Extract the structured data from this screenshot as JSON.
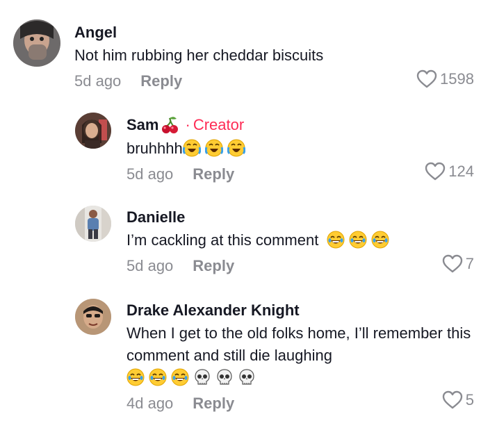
{
  "comments": [
    {
      "username": "Angel",
      "text": "Not him rubbing her cheddar biscuits",
      "time": "5d ago",
      "reply_label": "Reply",
      "likes": "1598"
    },
    {
      "username": "Sam",
      "creator_dot": "·",
      "creator_label": "Creator",
      "text": "bruhhhh",
      "time": "5d ago",
      "reply_label": "Reply",
      "likes": "124"
    },
    {
      "username": "Danielle",
      "text": "I’m cackling at this comment",
      "time": "5d ago",
      "reply_label": "Reply",
      "likes": "7"
    },
    {
      "username": "Drake Alexander Knight",
      "text": "When I get to the old folks home, I’ll remember this comment and still die laughing",
      "time": "4d ago",
      "reply_label": "Reply",
      "likes": "5"
    }
  ],
  "colors": {
    "text": "#161823",
    "muted": "#8a8b91",
    "creator": "#fe2c55"
  },
  "icons": [
    "heart-outline-icon",
    "cherry-icon",
    "crying-laughing-emoji",
    "tears-of-joy-emoji",
    "skull-emoji"
  ]
}
